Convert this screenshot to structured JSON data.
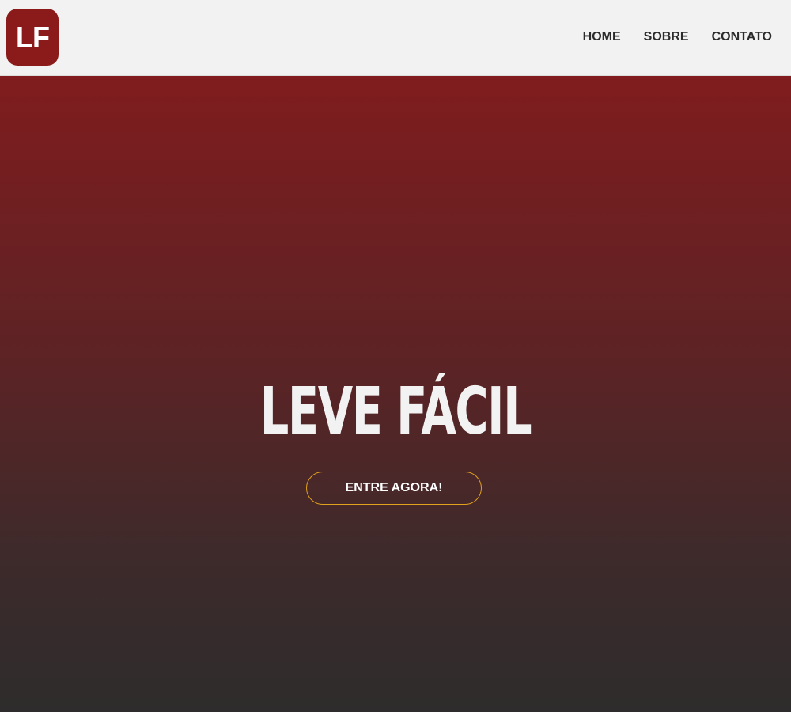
{
  "header": {
    "logo_text": "LF",
    "nav": [
      {
        "label": "HOME"
      },
      {
        "label": "SOBRE"
      },
      {
        "label": "CONTATO"
      }
    ]
  },
  "hero": {
    "title": "LEVE FÁCIL",
    "cta_label": "ENTRE AGORA!"
  },
  "colors": {
    "brand": "#8b1a1a",
    "header_bg": "#f2f2f2",
    "cta_border": "#e0a11c",
    "hero_top": "#801c1e",
    "hero_bottom": "#2e2c2c"
  }
}
